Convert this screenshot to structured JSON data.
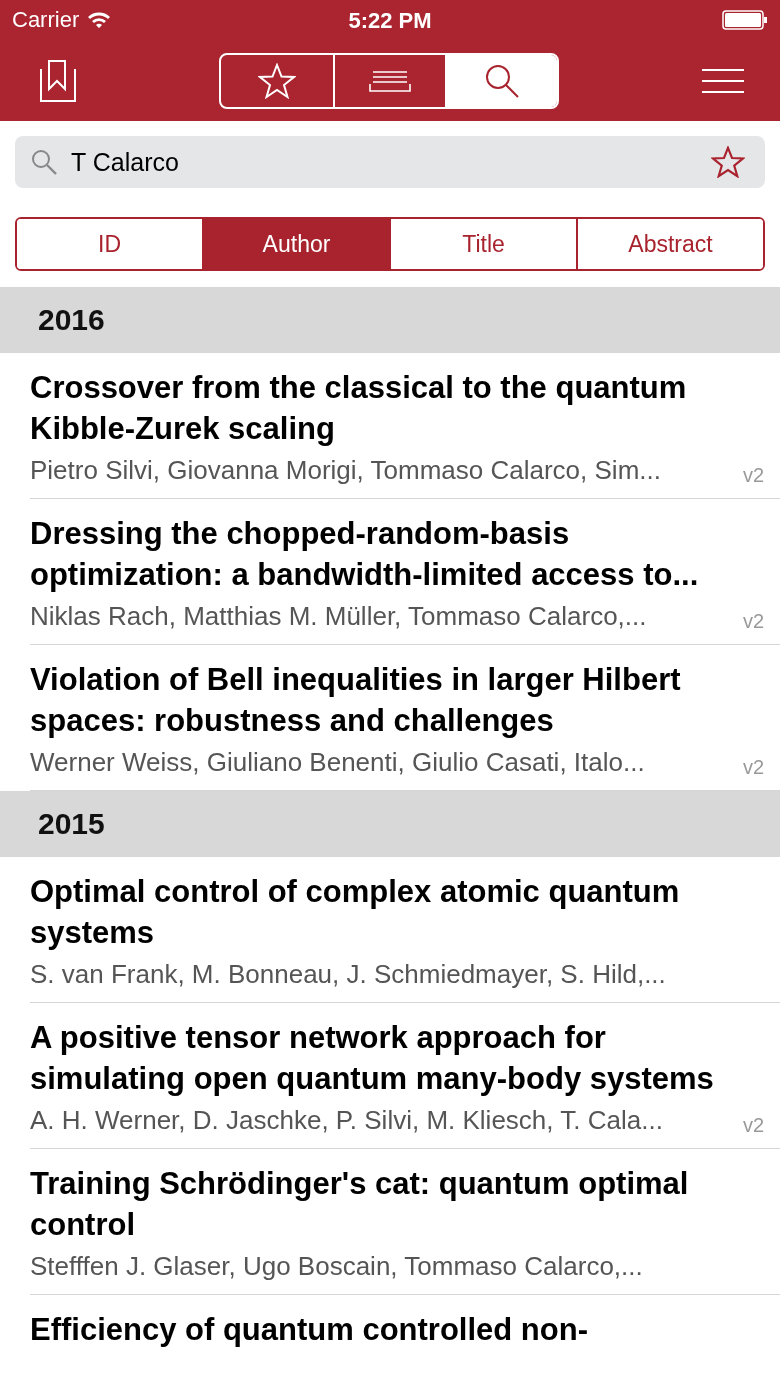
{
  "status_bar": {
    "carrier": "Carrier",
    "time": "5:22 PM"
  },
  "view_tabs": [
    {
      "kind": "favorites",
      "selected": false
    },
    {
      "kind": "list",
      "selected": false
    },
    {
      "kind": "search",
      "selected": true
    }
  ],
  "search": {
    "value": "T Calarco"
  },
  "filter_tabs": [
    {
      "label": "ID",
      "selected": false
    },
    {
      "label": "Author",
      "selected": true
    },
    {
      "label": "Title",
      "selected": false
    },
    {
      "label": "Abstract",
      "selected": false
    }
  ],
  "sections": [
    {
      "year": "2016",
      "papers": [
        {
          "title": "Crossover from the classical to the quantum Kibble-Zurek scaling",
          "authors": "Pietro Silvi, Giovanna Morigi, Tommaso Calarco, Sim...",
          "version": "v2"
        },
        {
          "title": "Dressing the chopped-random-basis optimization: a bandwidth-limited access to...",
          "authors": "Niklas Rach, Matthias M. Müller, Tommaso Calarco,...",
          "version": "v2"
        },
        {
          "title": "Violation of Bell inequalities in larger Hilbert spaces: robustness and challenges",
          "authors": "Werner Weiss, Giuliano Benenti, Giulio Casati, Italo...",
          "version": "v2"
        }
      ]
    },
    {
      "year": "2015",
      "papers": [
        {
          "title": "Optimal control of complex atomic quantum systems",
          "authors": "S. van Frank, M. Bonneau, J. Schmiedmayer, S. Hild,..."
        },
        {
          "title": "A positive tensor network approach for simulating open quantum many-body systems",
          "authors": "A. H. Werner, D. Jaschke, P. Silvi, M. Kliesch, T. Cala...",
          "version": "v2"
        },
        {
          "title": "Training Schrödinger's cat: quantum optimal control",
          "authors": "Stefffen J. Glaser, Ugo Boscain, Tommaso Calarco,..."
        },
        {
          "title": "Efficiency of quantum controlled non-"
        }
      ]
    }
  ]
}
